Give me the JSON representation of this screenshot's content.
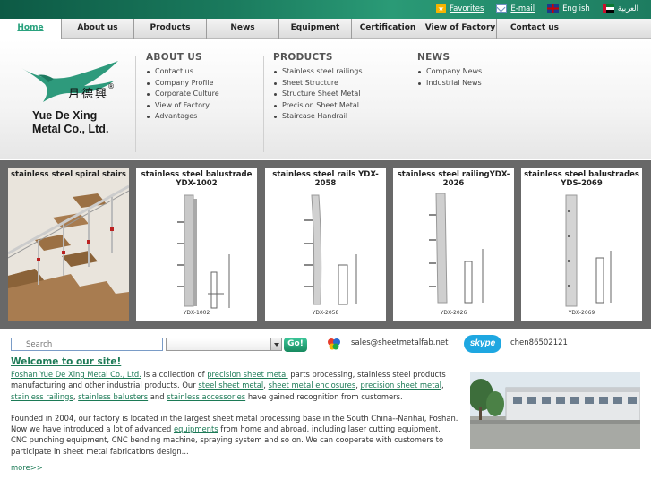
{
  "top_links": {
    "favorites": "Favorites",
    "email": "E-mail",
    "english": "English",
    "arabic": "العربية"
  },
  "nav": [
    "Home",
    "About us",
    "Products",
    "News",
    "Equipment",
    "Certification",
    "View of Factory",
    "Contact us"
  ],
  "logo": {
    "chinese": "月德興",
    "reg": "®",
    "line1": "Yue De Xing",
    "line2": "Metal Co., Ltd."
  },
  "menus": {
    "about": {
      "title": "ABOUT US",
      "items": [
        "Contact us",
        "Company Profile",
        "Corporate Culture",
        "View of Factory",
        "Advantages"
      ]
    },
    "products": {
      "title": "PRODUCTS",
      "items": [
        "Stainless steel railings",
        "Sheet Structure",
        "Structure Sheet Metal",
        "Precision Sheet Metal",
        "Staircase Handrail"
      ]
    },
    "news": {
      "title": "NEWS",
      "items": [
        "Company News",
        "Industrial News"
      ]
    }
  },
  "gallery": [
    {
      "title": "stainless steel spiral stairs",
      "caption": ""
    },
    {
      "title": "stainless steel balustrade YDX-1002",
      "caption": "YDX-1002"
    },
    {
      "title": "stainless steel rails YDX-2058",
      "caption": "YDX-2058"
    },
    {
      "title": "stainless steel railingYDX-2026",
      "caption": "YDX-2026"
    },
    {
      "title": "stainless steel balustrades YDS-2069",
      "caption": "YDX-2069"
    }
  ],
  "search": {
    "placeholder": "Search",
    "go": "Go!"
  },
  "contact": {
    "email": "sales@sheetmetalfab.net",
    "skype_label": "skype",
    "skype_id": "chen86502121"
  },
  "welcome": "Welcome to our site!",
  "para1": {
    "company": "Foshan Yue De Xing Metal Co., Ltd.",
    "t1": " is a collection of ",
    "l1": "precision sheet metal",
    "t2": " parts processing, stainless steel products manufacturing and other industrial products. Our ",
    "l2": "steel sheet metal",
    "t3": ", ",
    "l3": "sheet metal enclosures",
    "t4": ", ",
    "l4": "precision sheet metal",
    "t5": ", ",
    "l5": "stainless railings",
    "t6": ", ",
    "l6": "stainless balusters",
    "t7": " and ",
    "l7": "stainless accessories",
    "t8": " have gained recognition from customers."
  },
  "para2": {
    "t1": "Founded in 2004, our factory is located in the largest sheet metal processing base in the South China--Nanhai, Foshan. Now we have introduced a lot of advanced ",
    "l1": "equipments",
    "t2": " from home and abroad, including laser cutting equipment, CNC punching equipment, CNC bending machine, spraying system and so on. We can cooperate with customers to participate in sheet metal fabrications design..."
  },
  "more": "more>>",
  "colors": {
    "accent": "#1c7a56",
    "topbar": "#1a7a5d",
    "gallery_bg": "#686868"
  }
}
